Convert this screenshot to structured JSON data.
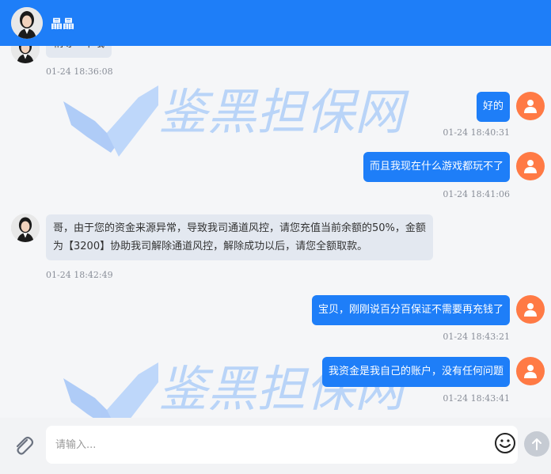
{
  "header": {
    "contact_name": "晶晶",
    "avatar_icon": "female-avatar-icon"
  },
  "watermark": {
    "text": "鉴黑担保网"
  },
  "messages": [
    {
      "side": "left",
      "text": "稍等一下哦",
      "time": "01-24 18:36:08"
    },
    {
      "side": "right",
      "text": "好的",
      "time": "01-24 18:40:31"
    },
    {
      "side": "right",
      "text": "而且我现在什么游戏都玩不了",
      "time": "01-24 18:41:06"
    },
    {
      "side": "left",
      "text_line1": "哥，由于您的资金来源异常，导致我司通道风控，请您充值当前余额的50%，金额",
      "text_line2": "为【3200】协助我司解除通道风控，解除成功以后，请您全额取款。",
      "time": "01-24 18:42:49"
    },
    {
      "side": "right",
      "text": "宝贝，刚刚说百分百保证不需要再充钱了",
      "time": "01-24 18:43:21"
    },
    {
      "side": "right",
      "text": "我资金是我自己的账户，没有任何问题",
      "time": "01-24 18:43:41"
    }
  ],
  "composer": {
    "placeholder": "请输入...",
    "attach_icon": "paperclip-icon",
    "emoji_icon": "emoji-icon",
    "send_icon": "send-arrow-icon"
  },
  "colors": {
    "header": "#1e7ef8",
    "bubble_right": "#1e7ef8",
    "bubble_left": "#e3e8f0",
    "user_avatar": "#ff7a45"
  }
}
